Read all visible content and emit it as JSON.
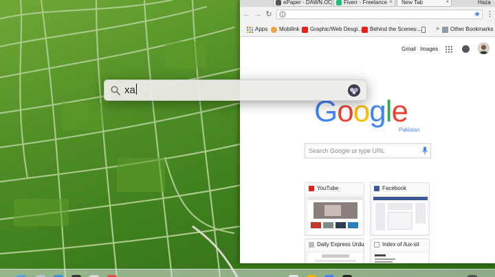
{
  "browser": {
    "tabs": [
      {
        "label": "ePaper - DAWN.CO",
        "favicon": "dawn-icon",
        "active": false
      },
      {
        "label": "Fiverr - Freelance",
        "favicon": "fiverr-icon",
        "active": false
      },
      {
        "label": "New Tab",
        "favicon": "newtab-icon",
        "active": true
      }
    ],
    "profile_label": "Haza",
    "omnibox": {
      "value": "",
      "icons": [
        "info-icon",
        "star-icon"
      ]
    },
    "bookmarks": [
      {
        "label": "Apps",
        "icon": "apps-grid-icon"
      },
      {
        "label": "Mobilink",
        "icon": "mobilink-icon"
      },
      {
        "label": "Graphic/Web Desgi...",
        "icon": "youtube-icon"
      },
      {
        "label": "Behind the Scenes:...",
        "icon": "youtube-icon"
      },
      {
        "label": "",
        "icon": "document-icon"
      },
      {
        "label": "Other Bookmarks",
        "icon": "folder-icon"
      }
    ],
    "bookmarks_more": "»"
  },
  "ntp": {
    "gmail": "Gmail",
    "images": "Images",
    "logo": [
      "G",
      "o",
      "o",
      "g",
      "l",
      "e"
    ],
    "logo_colors": [
      "#4285f4",
      "#ea4335",
      "#fbbc05",
      "#4285f4",
      "#34a853",
      "#ea4335"
    ],
    "logo_sub": "Pakistan",
    "search_placeholder": "Search Google or type URL",
    "tiles": [
      {
        "title": "YouTube",
        "icon": "youtube-icon"
      },
      {
        "title": "Facebook",
        "icon": "facebook-icon"
      },
      {
        "title": "Daily Express Urdu N",
        "icon": "page-icon"
      },
      {
        "title": "Index of /lux-sit",
        "icon": "page-icon"
      }
    ]
  },
  "spotlight": {
    "query": "xa",
    "icon": "search-icon",
    "app_icon": "app-icon"
  },
  "colors": {
    "accent": "#4a86e8",
    "youtube": "#e62117",
    "facebook": "#3b5998"
  }
}
